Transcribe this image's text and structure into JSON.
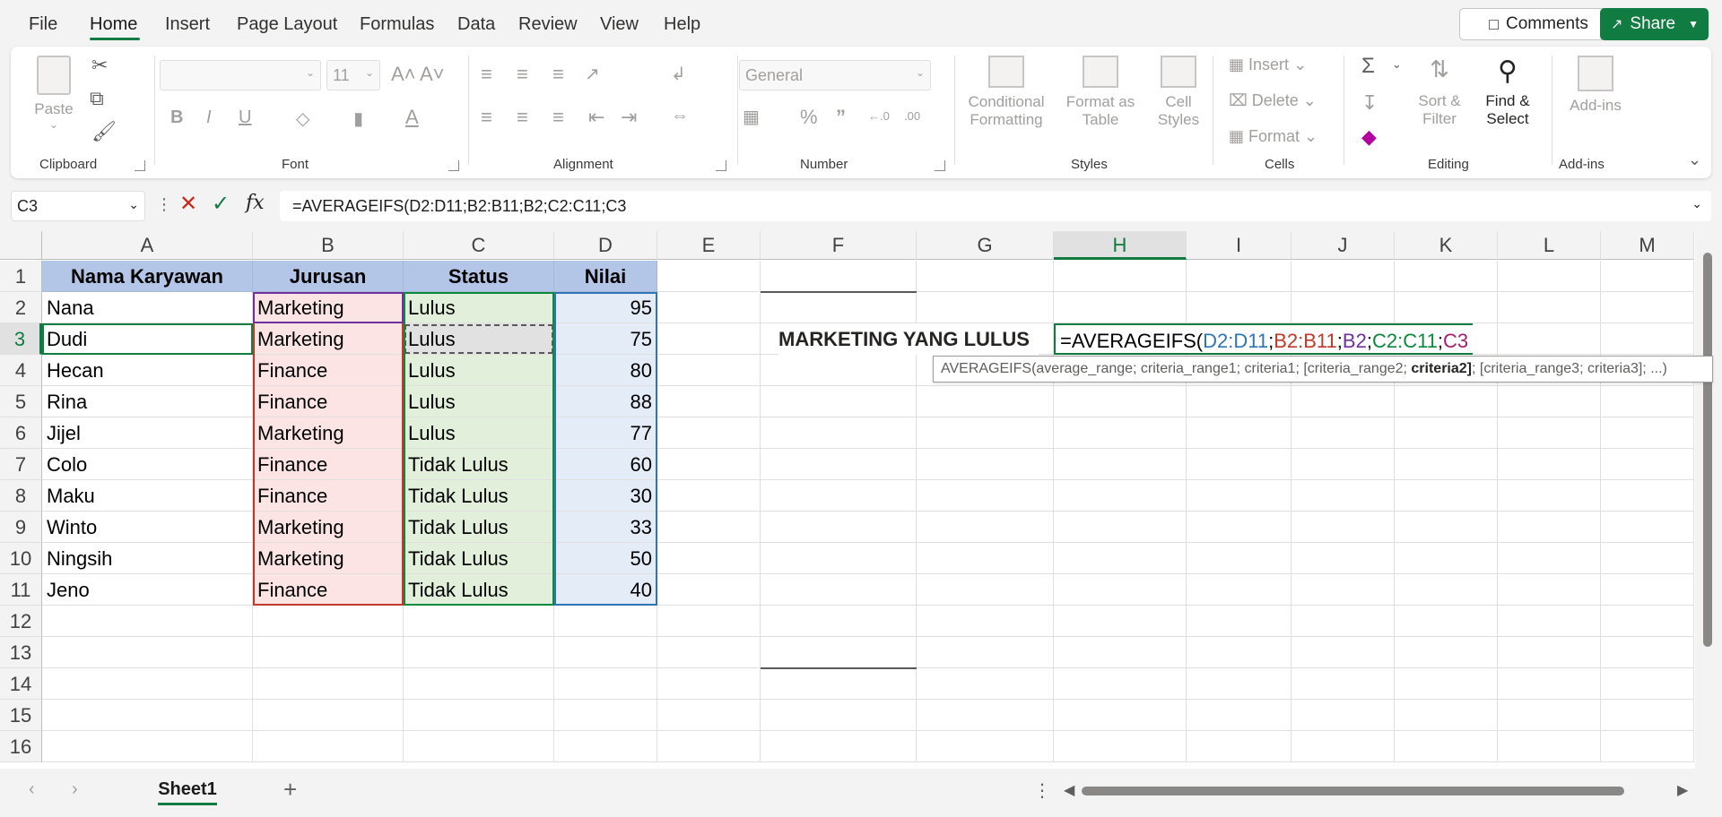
{
  "menu": {
    "tabs": [
      "File",
      "Home",
      "Insert",
      "Page Layout",
      "Formulas",
      "Data",
      "Review",
      "View",
      "Help"
    ],
    "comments_label": "Comments",
    "share_label": "Share"
  },
  "ribbon": {
    "clipboard": {
      "paste": "Paste",
      "label": "Clipboard"
    },
    "font": {
      "size": "11",
      "label": "Font",
      "bold": "B",
      "italic": "I",
      "underline": "U",
      "grow": "A˄",
      "shrink": "A˅"
    },
    "alignment": {
      "label": "Alignment"
    },
    "number": {
      "format": "General",
      "label": "Number",
      "percent": "%",
      "comma": "”",
      "inc_dec": "·.0→.00",
      "dec_dec": ".00→.0"
    },
    "styles": {
      "conditional": "Conditional",
      "conditional2": "Formatting",
      "format_as": "Format as",
      "format_as2": "Table",
      "cell": "Cell",
      "cell2": "Styles",
      "label": "Styles"
    },
    "cells": {
      "insert": "Insert",
      "delete": "Delete",
      "format": "Format",
      "label": "Cells"
    },
    "editing": {
      "sort": "Sort &",
      "sort2": "Filter",
      "find": "Find &",
      "find2": "Select",
      "label": "Editing"
    },
    "addins": {
      "name": "Add-ins",
      "label": "Add-ins"
    }
  },
  "formula_bar": {
    "name_box": "C3",
    "formula": "=AVERAGEIFS(D2:D11;B2:B11;B2;C2:C11;C3"
  },
  "grid": {
    "columns": [
      "A",
      "B",
      "C",
      "D",
      "E",
      "F",
      "G",
      "H",
      "I",
      "J",
      "K",
      "L",
      "M"
    ],
    "rows": [
      "1",
      "2",
      "3",
      "4",
      "5",
      "6",
      "7",
      "8",
      "9",
      "10",
      "11",
      "12",
      "13",
      "14",
      "15",
      "16"
    ],
    "headers": [
      "Nama Karyawan",
      "Jurusan",
      "Status",
      "Nilai"
    ],
    "data": [
      [
        "Nana",
        "Marketing",
        "Lulus",
        "95"
      ],
      [
        "Dudi",
        "Marketing",
        "Lulus",
        "75"
      ],
      [
        "Hecan",
        "Finance",
        "Lulus",
        "80"
      ],
      [
        "Rina",
        "Finance",
        "Lulus",
        "88"
      ],
      [
        "Jijel",
        "Marketing",
        "Lulus",
        "77"
      ],
      [
        "Colo",
        "Finance",
        "Tidak Lulus",
        "60"
      ],
      [
        "Maku",
        "Finance",
        "Tidak Lulus",
        "30"
      ],
      [
        "Winto",
        "Marketing",
        "Tidak Lulus",
        "33"
      ],
      [
        "Ningsih",
        "Marketing",
        "Tidak Lulus",
        "50"
      ],
      [
        "Jeno",
        "Finance",
        "Tidak Lulus",
        "40"
      ]
    ],
    "label_f3": "MARKETING YANG LULUS",
    "edit": {
      "fn": "=AVERAGEIFS(",
      "p1": "D2:D11",
      "p2": "B2:B11",
      "p3": "B2",
      "p4": "C2:C11",
      "p5": "C3",
      "sep": ";"
    },
    "tooltip": {
      "pre": "AVERAGEIFS(average_range; criteria_range1; criteria1; [criteria_range2; ",
      "bold": "criteria2]",
      "post": "; [criteria_range3; criteria3]; ...)"
    }
  },
  "sheets": {
    "tabs": [
      "Sheet1"
    ],
    "add": "+"
  },
  "colors": {
    "accent": "#107c41",
    "header_fill": "#b4c6e7",
    "ref_blue": "#2e75b6",
    "ref_red": "#c0392b",
    "ref_purple": "#7030a0",
    "ref_green": "#0b8a3e",
    "ref_magenta": "#a0226e"
  }
}
